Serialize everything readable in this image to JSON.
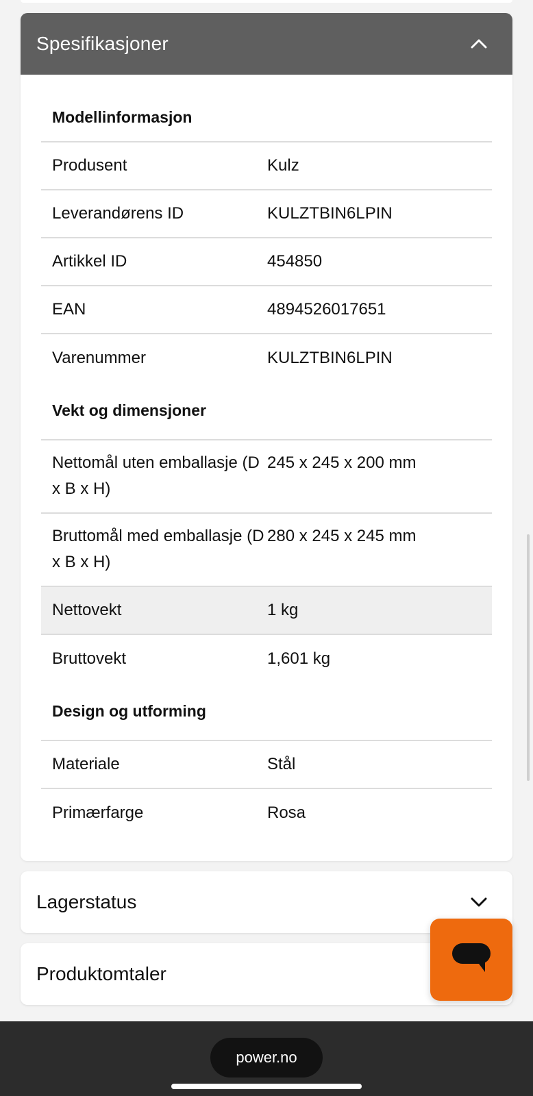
{
  "specifications": {
    "header_title": "Spesifikasjoner",
    "sections": [
      {
        "title": "Modellinformasjon",
        "rows": [
          {
            "label": "Produsent",
            "value": "Kulz"
          },
          {
            "label": "Leverandørens ID",
            "value": "KULZTBIN6LPIN"
          },
          {
            "label": "Artikkel ID",
            "value": "454850"
          },
          {
            "label": "EAN",
            "value": "4894526017651"
          },
          {
            "label": "Varenummer",
            "value": "KULZTBIN6LPIN"
          }
        ]
      },
      {
        "title": "Vekt og dimensjoner",
        "rows": [
          {
            "label": "Nettomål uten emballasje (D x B x H)",
            "value": "245 x 245 x 200 mm"
          },
          {
            "label": "Bruttomål med emballasje (D x B x H)",
            "value": "280 x 245 x 245 mm"
          },
          {
            "label": "Nettovekt",
            "value": "1 kg"
          },
          {
            "label": "Bruttovekt",
            "value": "1,601 kg"
          }
        ]
      },
      {
        "title": "Design og utforming",
        "rows": [
          {
            "label": "Materiale",
            "value": "Stål"
          },
          {
            "label": "Primærfarge",
            "value": "Rosa"
          }
        ]
      }
    ]
  },
  "accordions": {
    "stock": {
      "title": "Lagerstatus"
    },
    "reviews": {
      "title": "Produktomtaler"
    }
  },
  "browser": {
    "url": "power.no"
  },
  "colors": {
    "header_bg": "#5f5f5f",
    "chat_button": "#ee6a0e",
    "highlight_row": "#efefef"
  },
  "icons": {
    "collapse": "chevron-up-icon",
    "expand": "chevron-down-icon",
    "chat": "chat-bubble-icon"
  }
}
